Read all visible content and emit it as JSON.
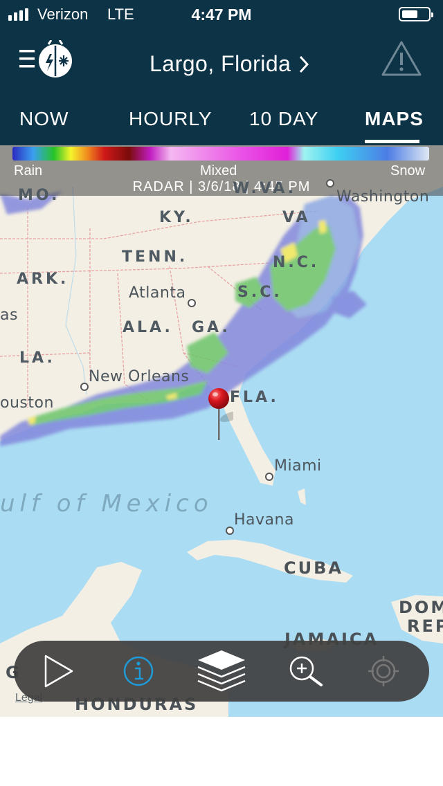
{
  "status_bar": {
    "carrier": "Verizon",
    "network": "LTE",
    "time": "4:47 PM",
    "battery_level": 0.6,
    "signal_bars": 4
  },
  "header": {
    "location": "Largo,  Florida",
    "icons": {
      "menu": "menu-logo-icon",
      "chevron": "chevron-right-icon",
      "alert": "alert-triangle-icon"
    }
  },
  "tabs": [
    {
      "label": "NOW",
      "active": false
    },
    {
      "label": "HOURLY",
      "active": false
    },
    {
      "label": "10  DAY",
      "active": false
    },
    {
      "label": "MAPS",
      "active": true
    }
  ],
  "legend": {
    "rain": "Rain",
    "mixed": "Mixed",
    "snow": "Snow",
    "radar_caption": "RADAR  |  3/6/18  |  4:45 PM"
  },
  "map": {
    "labels": {
      "mo": "MO.",
      "wva": "W.VA.",
      "washington": "Washington",
      "ky": "KY.",
      "va": "VA",
      "tenn": "TENN.",
      "nc": "N.C.",
      "ark": "ARK.",
      "atlanta": "Atlanta",
      "sc": "S.C.",
      "as": "as",
      "ala": "ALA.",
      "ga": "GA.",
      "la": "LA.",
      "new_orleans": "New Orleans",
      "houston": "ouston",
      "fla": "FLA.",
      "miami": "Miami",
      "gulf": "ulf  of  Mexico",
      "havana": "Havana",
      "cuba": "CUBA",
      "dom": "DOM",
      "rep": "REP",
      "jamaica": "JAMAICA",
      "honduras": "HONDURAS",
      "g": "G"
    },
    "legal": "Legal"
  },
  "toolbar": {
    "buttons": [
      {
        "name": "play-button",
        "icon": "play-icon"
      },
      {
        "name": "info-button",
        "icon": "info-icon"
      },
      {
        "name": "layers-button",
        "icon": "layers-icon"
      },
      {
        "name": "zoom-button",
        "icon": "zoom-in-icon"
      },
      {
        "name": "locate-button",
        "icon": "crosshair-icon"
      }
    ],
    "info_color": "#1e9bd7"
  },
  "colors": {
    "header_bg": "#0d3347",
    "water": "#aadcf3",
    "land": "#f3efe4",
    "radar_green": "#58c55a",
    "radar_blue": "#6e70d8",
    "pin_red": "#d9161f"
  }
}
